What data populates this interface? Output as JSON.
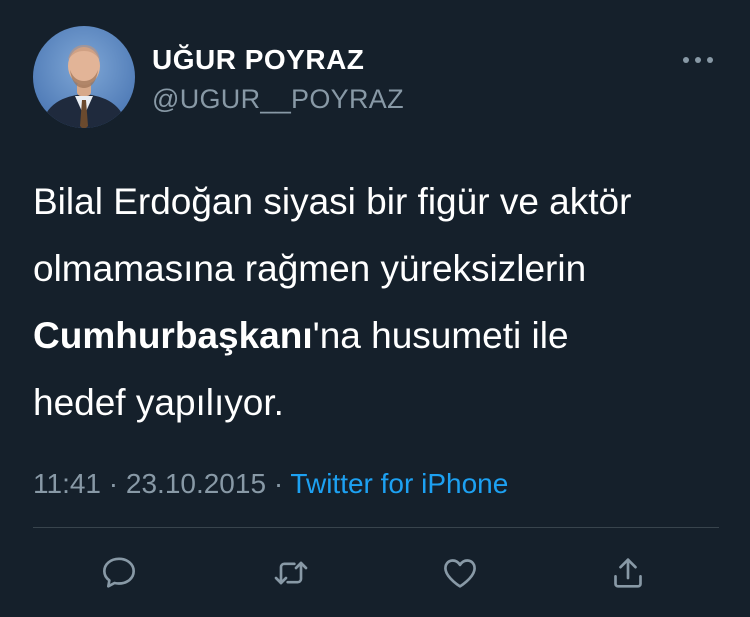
{
  "user": {
    "display_name": "UĞUR POYRAZ",
    "handle": "@UGUR__POYRAZ",
    "avatar_icon": "profile-photo"
  },
  "tweet": {
    "line1": "Bilal Erdoğan siyasi bir figür ve aktör",
    "line2": "olmamasına rağmen yüreksizlerin",
    "line3_bold": "Cumhurbaşkanı",
    "line3_rest": "'na husumeti ile",
    "line4": "hedef yapılıyor."
  },
  "meta": {
    "time": "11:41",
    "separator": "·",
    "date": "23.10.2015",
    "source": "Twitter for iPhone"
  },
  "actions": [
    {
      "name": "reply",
      "icon": "speech-bubble-icon"
    },
    {
      "name": "retweet",
      "icon": "retweet-arrows-icon"
    },
    {
      "name": "like",
      "icon": "heart-icon"
    },
    {
      "name": "share",
      "icon": "share-upload-icon"
    }
  ],
  "colors": {
    "background": "#15202b",
    "text": "#ffffff",
    "secondary_text": "#8899a6",
    "link": "#1da1f2",
    "divider": "#38444d"
  }
}
